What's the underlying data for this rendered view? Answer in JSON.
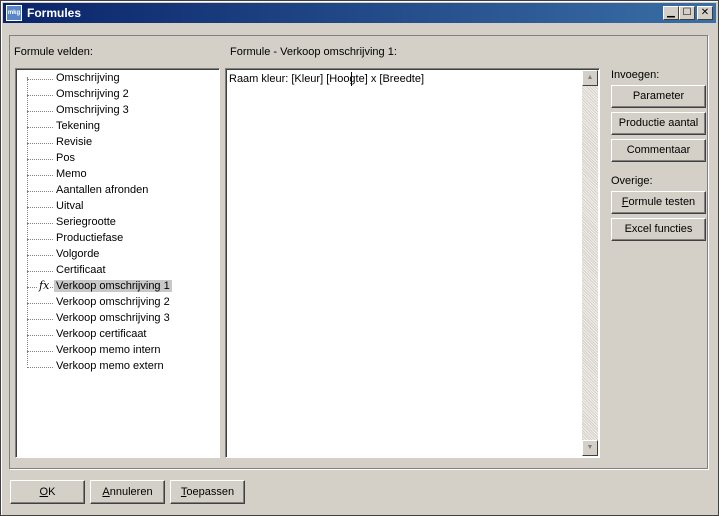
{
  "window": {
    "title": "Formules",
    "app_icon_text": "mkg",
    "controls": {
      "minimize": "▁",
      "maximize": "☐",
      "close": "✕"
    }
  },
  "labels": {
    "fields": "Formule velden:",
    "formula": "Formule - Verkoop omschrijving 1:",
    "insert": "Invoegen:",
    "other": "Overige:"
  },
  "tree": {
    "items": [
      {
        "label": "Omschrijving"
      },
      {
        "label": "Omschrijving 2"
      },
      {
        "label": "Omschrijving 3"
      },
      {
        "label": "Tekening"
      },
      {
        "label": "Revisie"
      },
      {
        "label": "Pos"
      },
      {
        "label": "Memo"
      },
      {
        "label": "Aantallen afronden"
      },
      {
        "label": "Uitval"
      },
      {
        "label": "Seriegrootte"
      },
      {
        "label": "Productiefase"
      },
      {
        "label": "Volgorde"
      },
      {
        "label": "Certificaat"
      },
      {
        "label": "Verkoop omschrijving 1",
        "selected": true,
        "icon": "fx"
      },
      {
        "label": "Verkoop omschrijving 2"
      },
      {
        "label": "Verkoop omschrijving 3"
      },
      {
        "label": "Verkoop certificaat"
      },
      {
        "label": "Verkoop memo intern"
      },
      {
        "label": "Verkoop memo extern"
      }
    ]
  },
  "editor": {
    "text": "Raam kleur: [Kleur] [Hoogte] x [Breedte]"
  },
  "buttons": {
    "parameter": "Parameter",
    "productie_aantal": "Productie aantal",
    "commentaar": "Commentaar",
    "formule_testen_first": "F",
    "formule_testen_rest": "ormule testen",
    "excel_functies": "Excel functies",
    "ok_first": "O",
    "ok_rest": "K",
    "annuleren_first": "A",
    "annuleren_rest": "nnuleren",
    "toepassen_first": "T",
    "toepassen_rest": "oepassen"
  },
  "scrollbar": {
    "up": "▲",
    "down": "▼"
  },
  "colors": {
    "titlebar_start": "#0a246a",
    "titlebar_end": "#3a6ea5",
    "face": "#d4d0c8",
    "selection": "#c8c8c8"
  }
}
